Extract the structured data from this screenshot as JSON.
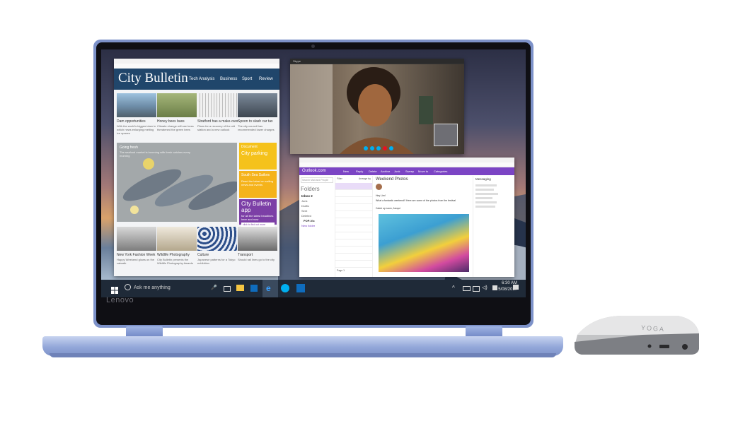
{
  "news": {
    "title": "City Bulletin",
    "nav": [
      "Tech Analysis",
      "Business",
      "Sport",
      "Review"
    ],
    "top_stories": [
      {
        "headline": "Dam opportunities",
        "blurb": "With the world's biggest dam in which news enlarging melting ice spaces"
      },
      {
        "headline": "Honey bees bass",
        "blurb": "Climate change will see bees threatened the green bees"
      },
      {
        "headline": "Stratford has a make-over",
        "blurb": "Plans for a recovery of the old station and a new outlook"
      },
      {
        "headline": "Spoon to slash car tax",
        "blurb": "The city council has recommended lower charges"
      }
    ],
    "feature": {
      "label": "Going fresh",
      "text": "The seafood market is booming with fresh catches every morning"
    },
    "promo_blocks": [
      {
        "title": "Document",
        "text": "City parking"
      },
      {
        "title": "South Sea Sailors",
        "text": "Read the latest on sailing news and events"
      }
    ],
    "app_promo": {
      "title": "City Bulletin app",
      "text": "for all the latest headlines here and now",
      "button": "click to find out more"
    },
    "bottom_stories": [
      {
        "headline": "New York Fashion Week",
        "blurb": "Happy Weekend glows on the catwalk"
      },
      {
        "headline": "Wildlife Photography",
        "blurb": "City Bulletin presents the Wildlife Photography Awards"
      },
      {
        "headline": "Culture",
        "blurb": "Japanese patterns for a Tokyo exhibition"
      },
      {
        "headline": "Transport",
        "blurb": "Should rail lines go to the city"
      }
    ]
  },
  "skype": {
    "titlebar": "Skype"
  },
  "outlook": {
    "brand": "Outlook.com",
    "toolbar": [
      "New",
      "Reply",
      "Delete",
      "Archive",
      "Junk",
      "Sweep",
      "Move to",
      "Categories"
    ],
    "search_placeholder": "Search Mail and People",
    "folders_heading": "Folders",
    "folders": [
      "Inbox 2",
      "Junk",
      "Drafts",
      "Sent",
      "Deleted",
      "POP-Vic",
      "New folder"
    ],
    "filter_label": "Filter",
    "arrange_label": "Arrange by",
    "subject": "Weekend Photos",
    "body_line1": "Hey Lim!",
    "body_line2": "What a fantastic weekend!! Here are some of the photos from the festival",
    "body_line3": "Catch up soon, Jacqui",
    "messaging_heading": "Messaging",
    "pager": "Page 1"
  },
  "taskbar": {
    "search_placeholder": "Ask me anything",
    "time": "6:30 AM",
    "date": "5/08/2017"
  },
  "laptop_logo": "Lenovo",
  "device_logo": "YOGA",
  "colors": {
    "accent_news": "#20466b",
    "outlook_purple": "#7b44c4",
    "taskbar": "#1f2a38",
    "chassis": "#7d92c9"
  }
}
